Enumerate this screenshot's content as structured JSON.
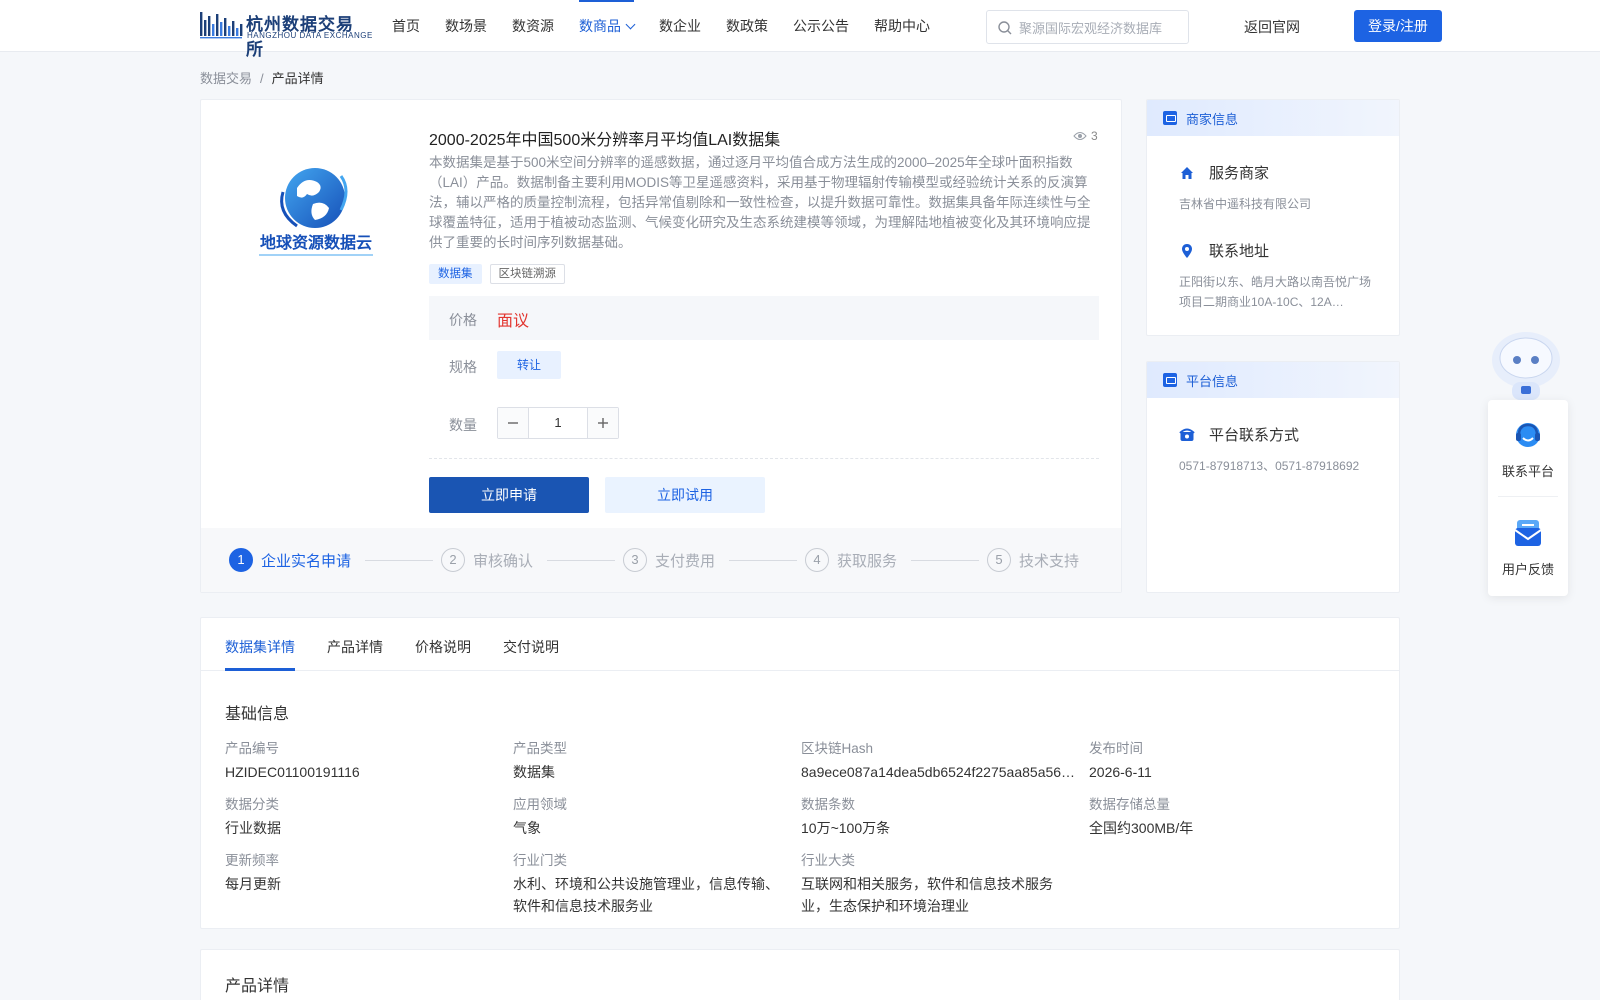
{
  "header": {
    "logo_cn": "杭州数据交易所",
    "logo_en": "HANGZHOU DATA EXCHANGE",
    "nav": [
      {
        "label": "首页"
      },
      {
        "label": "数场景"
      },
      {
        "label": "数资源"
      },
      {
        "label": "数商品",
        "active": true
      },
      {
        "label": "数企业"
      },
      {
        "label": "数政策"
      },
      {
        "label": "公示公告"
      },
      {
        "label": "帮助中心"
      }
    ],
    "search_placeholder": "聚源国际宏观经济数据库",
    "back_link": "返回官网",
    "login": "登录/注册",
    "accent_color": "#1d63e3"
  },
  "breadcrumb": {
    "root": "数据交易",
    "separator": "/",
    "current": "产品详情"
  },
  "product": {
    "logo_text": "地球资源数据云",
    "title": "2000-2025年中国500米分辨率月平均值LAI数据集",
    "views": "3",
    "description": "本数据集是基于500米空间分辨率的遥感数据，通过逐月平均值合成方法生成的2000–2025年全球叶面积指数（LAI）产品。数据制备主要利用MODIS等卫星遥感资料，采用基于物理辐射传输模型或经验统计关系的反演算法，辅以严格的质量控制流程，包括异常值剔除和一致性检查，以提升数据可靠性。数据集具备年际连续性与全球覆盖特征，适用于植被动态监测、气候变化研究及生态系统建模等领域，为理解陆地植被变化及其环境响应提供了重要的长时间序列数据基础。",
    "tags": [
      "数据集",
      "区块链溯源"
    ],
    "price_label": "价格",
    "price_value": "面议",
    "spec_label": "规格",
    "spec_value": "转让",
    "qty_label": "数量",
    "qty_value": "1",
    "apply_button": "立即申请",
    "trial_button": "立即试用",
    "price_color": "#e2352f"
  },
  "steps": [
    {
      "num": "1",
      "label": "企业实名申请",
      "active": true
    },
    {
      "num": "2",
      "label": "审核确认"
    },
    {
      "num": "3",
      "label": "支付费用"
    },
    {
      "num": "4",
      "label": "获取服务"
    },
    {
      "num": "5",
      "label": "技术支持"
    }
  ],
  "merchant": {
    "header": "商家信息",
    "service_label": "服务商家",
    "service_value": "吉林省中遥科技有限公司",
    "address_label": "联系地址",
    "address_value": "正阳街以东、皓月大路以南吾悦广场项目二期商业10A-10C、12A…"
  },
  "platform": {
    "header": "平台信息",
    "contact_label": "平台联系方式",
    "contact_value": "0571-87918713、0571-87918692"
  },
  "float": {
    "contact_label": "联系平台",
    "feedback_label": "用户反馈"
  },
  "detail": {
    "tabs": [
      "数据集详情",
      "产品详情",
      "价格说明",
      "交付说明"
    ],
    "section_title": "基础信息",
    "fields": [
      {
        "k": "产品编号",
        "v": "HZIDEC01100191116"
      },
      {
        "k": "产品类型",
        "v": "数据集"
      },
      {
        "k": "区块链Hash",
        "v": "8a9ece087a14dea5db6524f2275aa85a56…"
      },
      {
        "k": "发布时间",
        "v": "2026-6-11"
      },
      {
        "k": "数据分类",
        "v": "行业数据"
      },
      {
        "k": "应用领域",
        "v": "气象"
      },
      {
        "k": "数据条数",
        "v": "10万~100万条"
      },
      {
        "k": "数据存储总量",
        "v": "全国约300MB/年"
      },
      {
        "k": "更新频率",
        "v": "每月更新"
      },
      {
        "k": "行业门类",
        "v": "水利、环境和公共设施管理业，信息传输、软件和信息技术服务业"
      },
      {
        "k": "行业大类",
        "v": "互联网和相关服务，软件和信息技术服务业，生态保护和环境治理业"
      }
    ],
    "section2_title": "产品详情"
  }
}
